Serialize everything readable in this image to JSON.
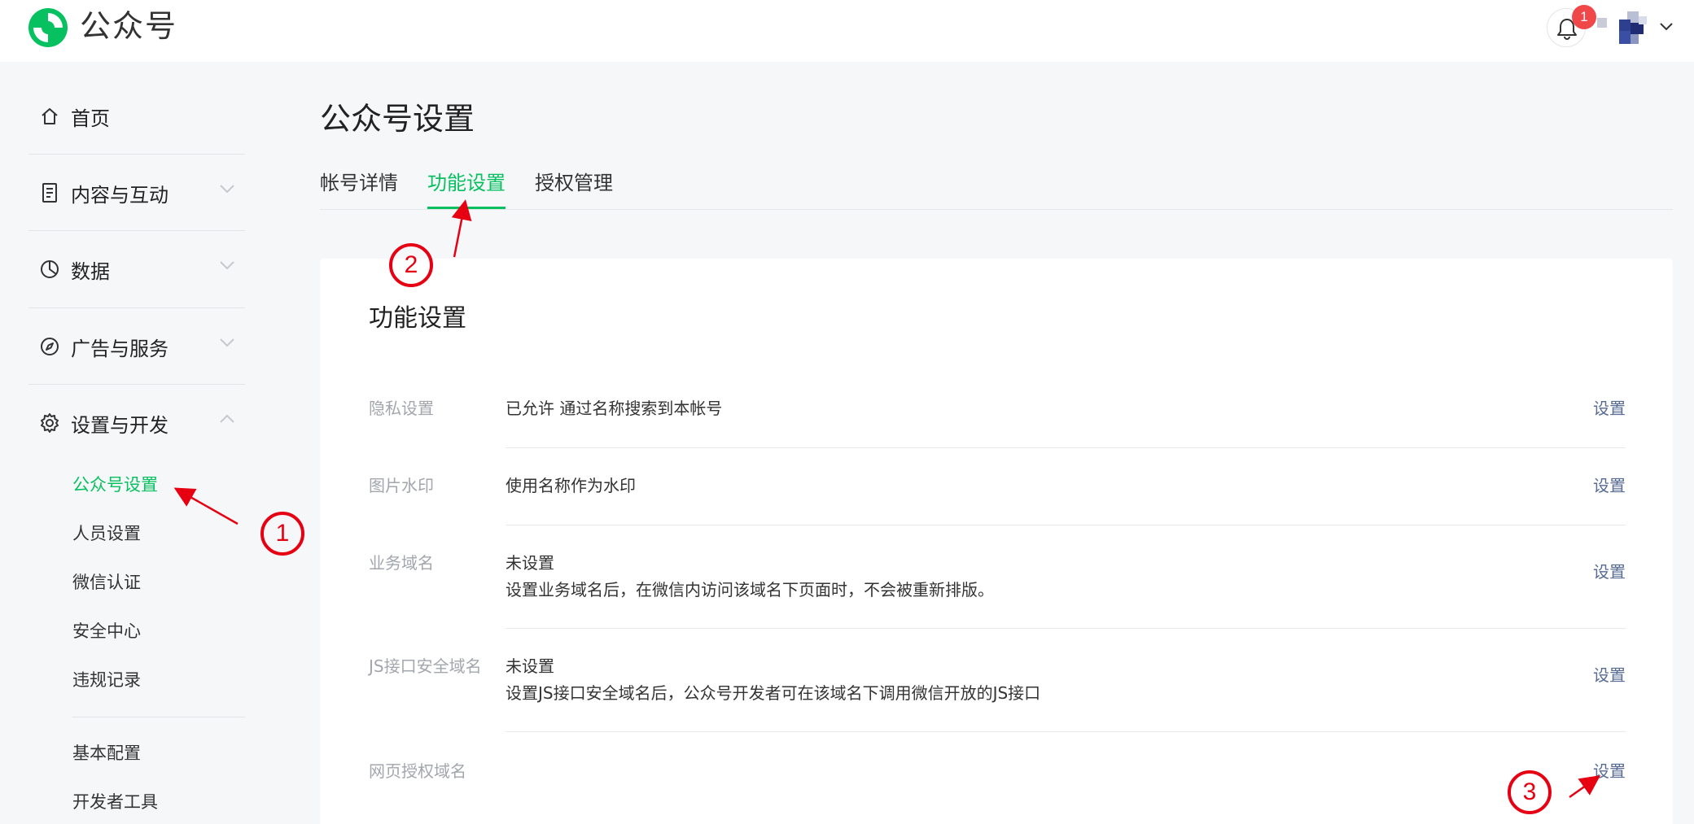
{
  "header": {
    "brand": "公众号",
    "notification_count": "1"
  },
  "sidebar": {
    "items": [
      {
        "label": "首页",
        "icon": "home-icon"
      },
      {
        "label": "内容与互动",
        "icon": "document-icon"
      },
      {
        "label": "数据",
        "icon": "pie-chart-icon"
      },
      {
        "label": "广告与服务",
        "icon": "compass-icon"
      },
      {
        "label": "设置与开发",
        "icon": "gear-icon"
      }
    ],
    "sub_items": [
      "公众号设置",
      "人员设置",
      "微信认证",
      "安全中心",
      "违规记录"
    ],
    "sub_items_2": [
      "基本配置",
      "开发者工具"
    ]
  },
  "main": {
    "title": "公众号设置",
    "tabs": [
      "帐号详情",
      "功能设置",
      "授权管理"
    ],
    "card": {
      "title": "功能设置",
      "rows": [
        {
          "label": "隐私设置",
          "value": "已允许 通过名称搜索到本帐号",
          "desc": "",
          "link": "设置"
        },
        {
          "label": "图片水印",
          "value": "使用名称作为水印",
          "desc": "",
          "link": "设置"
        },
        {
          "label": "业务域名",
          "value": "未设置",
          "desc": "设置业务域名后，在微信内访问该域名下页面时，不会被重新排版。",
          "link": "设置"
        },
        {
          "label": "JS接口安全域名",
          "value": "未设置",
          "desc": "设置JS接口安全域名后，公众号开发者可在该域名下调用微信开放的JS接口",
          "link": "设置"
        },
        {
          "label": "网页授权域名",
          "value": "",
          "desc": "",
          "link": "设置"
        }
      ]
    }
  },
  "annotations": [
    "1",
    "2",
    "3"
  ],
  "colors": {
    "accent": "#07c160",
    "link": "#576b95",
    "annotation": "#e60012",
    "badge": "#f04848"
  }
}
